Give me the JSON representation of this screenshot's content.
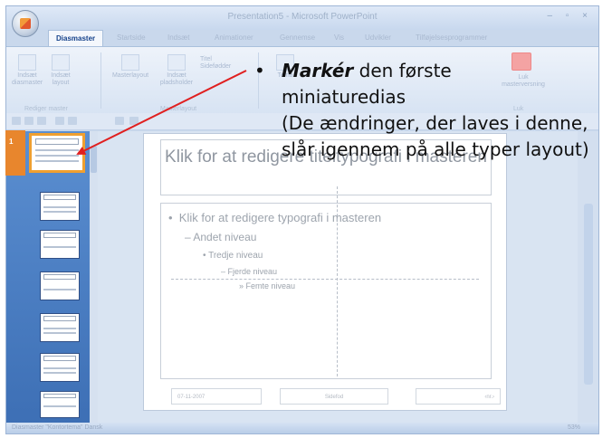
{
  "app": {
    "title": "Presentation5 - Microsoft PowerPoint",
    "window_controls": "–  ▫  ×"
  },
  "ribbon_tabs": [
    "Diasmaster",
    "Startside",
    "Indsæt",
    "Animationer",
    "Gennemse",
    "Vis",
    "Udvikler",
    "Tilføjelsesprogrammer"
  ],
  "ribbon": {
    "insert_slide_master": "Indsæt diasmaster",
    "insert_layout": "Indsæt layout",
    "group_edit_master": "Rediger master",
    "master_layout": "Masterlayout",
    "insert_placeholder": "Indsæt pladsholder",
    "title_check": "Titel",
    "footers_check": "Sidefødder",
    "group_master_layout": "Masterlayout",
    "themes": "Tema",
    "close_master": "Luk masterversning",
    "group_close": "Luk"
  },
  "slide": {
    "title_placeholder": "Klik for at redigere titeltypografi i masteren",
    "level1": "Klik for at redigere typografi i masteren",
    "level2": "Andet niveau",
    "level3": "Tredje niveau",
    "level4": "Fjerde niveau",
    "level5": "Femte niveau",
    "footer_date": "07-11-2007",
    "footer_center": "Sidefod",
    "footer_number": "‹nr.›"
  },
  "thumbnails": {
    "selected_number": "1"
  },
  "status": {
    "left": "Diasmaster   \"Kontortema\"   Dansk",
    "right": "53%"
  },
  "callout": {
    "bullet": "•",
    "emphasis": "Markér",
    "line1_rest": " den første",
    "line2": "miniaturedias",
    "line3": "(De ændringer, der laves i denne, slår igennem på alle typer layout)"
  },
  "colors": {
    "arrow": "#e02020",
    "selection": "#f0a030",
    "ribbon_accent": "#15428b"
  }
}
